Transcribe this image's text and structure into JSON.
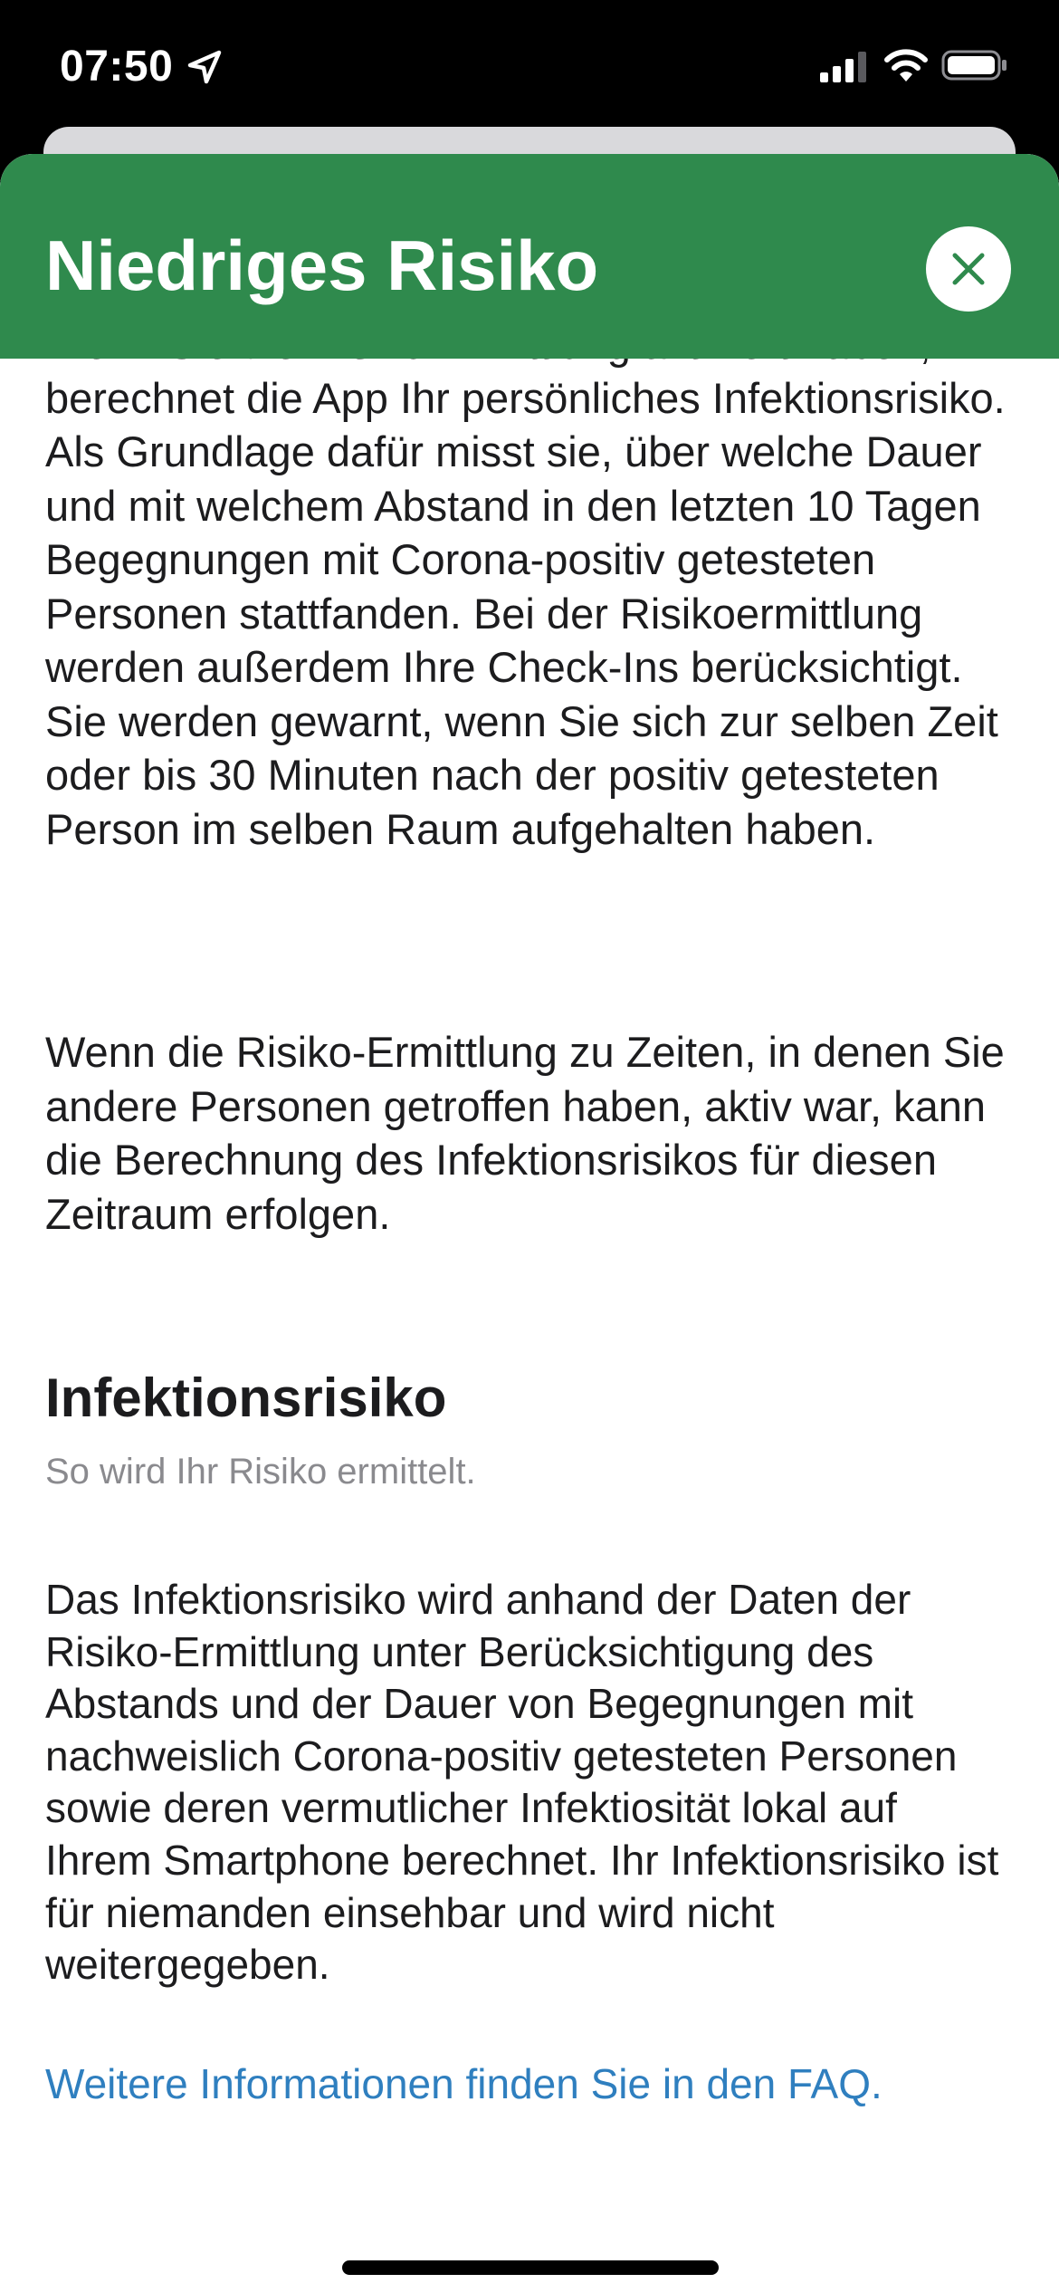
{
  "status_bar": {
    "time": "07:50",
    "location_icon": "location-arrow-icon",
    "signal_icon": "cellular-signal-icon",
    "wifi_icon": "wifi-icon",
    "battery_icon": "battery-icon"
  },
  "header": {
    "title": "Niedriges Risiko",
    "background_color": "#2f8a4d",
    "close_icon": "close-icon"
  },
  "content": {
    "paragraph_1": "Wenn Sie die Risiko-Ermittlung aktiviert haben, berechnet die App Ihr persönliches Infektionsrisiko. Als Grundlage dafür misst sie, über welche Dauer und mit welchem Abstand in den letzten 10 Tagen Begegnungen mit Corona-positiv getesteten Personen stattfanden. Bei der Risikoermittlung werden außerdem Ihre Check-Ins berücksichtigt. Sie werden gewarnt, wenn Sie sich zur selben Zeit oder bis 30 Minuten nach der positiv getesteten Person im selben Raum aufgehalten haben.",
    "paragraph_2": "Wenn die Risiko-Ermittlung zu Zeiten, in denen Sie andere Personen getroffen haben, aktiv war, kann die Berechnung des Infektionsrisikos für diesen Zeitraum erfolgen.",
    "section_heading": "Infektionsrisiko",
    "section_subtitle": "So wird Ihr Risiko ermittelt.",
    "paragraph_3": "Das Infektionsrisiko wird anhand der Daten der Risiko-Ermittlung unter Berücksichtigung des Abstands und der Dauer von Begegnungen mit nachweislich Corona-positiv getesteten Personen sowie deren vermutlicher Infektiosität lokal auf Ihrem Smartphone berechnet. Ihr Infektionsrisiko ist für niemanden einsehbar und wird nicht weitergegeben.",
    "faq_link": "Weitere Informationen finden Sie in den FAQ.",
    "link_color": "#2f7fbf"
  }
}
